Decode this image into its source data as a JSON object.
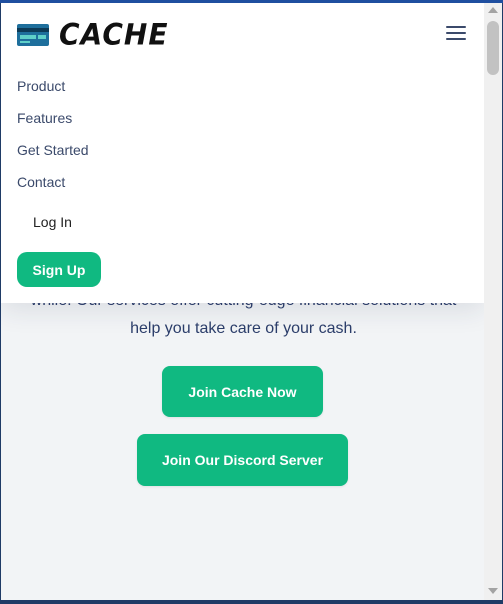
{
  "brand": {
    "name": "CACHE",
    "icon": "credit-card-icon",
    "accent": "#10b981"
  },
  "menu": {
    "items": [
      {
        "label": "Product"
      },
      {
        "label": "Features"
      },
      {
        "label": "Get Started"
      },
      {
        "label": "Contact"
      }
    ],
    "login_label": "Log In",
    "signup_label": "Sign Up"
  },
  "hero": {
    "line1": "while. Our services offer cutting-edge financial solutions that",
    "line2": "help you take care of your cash.",
    "join_label": "Join Cache Now",
    "discord_label": "Join Our Discord Server"
  },
  "icons": {
    "menu": "hamburger-menu-icon"
  }
}
